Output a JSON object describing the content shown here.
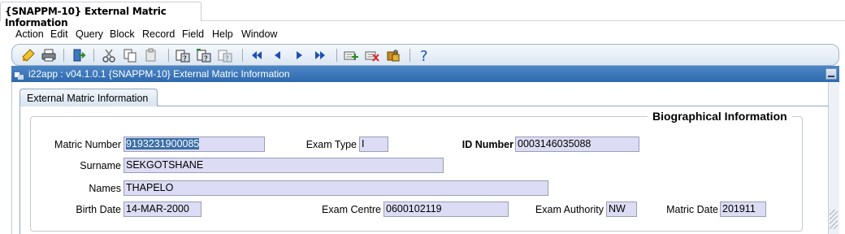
{
  "window_tab": {
    "title": "{SNAPPM-10} External Matric Information"
  },
  "menu": [
    "Action",
    "Edit",
    "Query",
    "Block",
    "Record",
    "Field",
    "Help",
    "Window"
  ],
  "toolbar_icons": [
    "save-icon",
    "print-icon",
    "exit-icon",
    "cut-icon",
    "copy-icon",
    "paste-icon",
    "enter-query-icon",
    "execute-query-icon",
    "cancel-query-icon",
    "first-record-icon",
    "previous-record-icon",
    "next-record-icon",
    "last-record-icon",
    "insert-record-icon",
    "delete-record-icon",
    "lock-record-icon",
    "help-icon"
  ],
  "form_window": {
    "title": "i22app : v04.1.0.1  {SNAPPM-10} External Matric Information"
  },
  "tab": {
    "label": "External Matric Information"
  },
  "group": {
    "title": "Biographical Information"
  },
  "fields": {
    "matric_number": {
      "label": "Matric Number",
      "value": "9193231900085"
    },
    "exam_type": {
      "label": "Exam Type",
      "value": "I"
    },
    "id_number": {
      "label": "ID Number",
      "value": "0003146035088"
    },
    "surname": {
      "label": "Surname",
      "value": "SEKGOTSHANE"
    },
    "names": {
      "label": "Names",
      "value": "THAPELO"
    },
    "birth_date": {
      "label": "Birth Date",
      "value": "14-MAR-2000"
    },
    "exam_centre": {
      "label": "Exam Centre",
      "value": "0600102119"
    },
    "exam_authority": {
      "label": "Exam Authority",
      "value": "NW"
    },
    "matric_date": {
      "label": "Matric Date",
      "value": "201911"
    }
  }
}
